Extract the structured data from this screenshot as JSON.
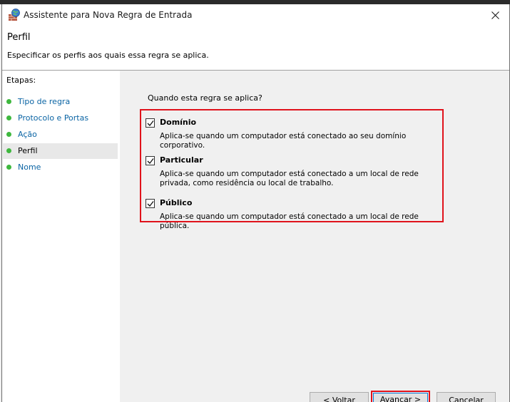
{
  "window": {
    "title": "Assistente para Nova Regra de Entrada"
  },
  "header": {
    "title": "Perfil",
    "subtitle": "Especificar os perfis aos quais essa regra se aplica."
  },
  "steps": {
    "heading": "Etapas:",
    "items": [
      {
        "label": "Tipo de regra"
      },
      {
        "label": "Protocolo e Portas"
      },
      {
        "label": "Ação"
      },
      {
        "label": "Perfil"
      },
      {
        "label": "Nome"
      }
    ]
  },
  "content": {
    "question": "Quando esta regra se aplica?",
    "options": [
      {
        "label": "Domínio",
        "checked": true,
        "description": "Aplica-se quando um computador está conectado ao seu domínio corporativo."
      },
      {
        "label": "Particular",
        "checked": true,
        "description": "Aplica-se quando um computador está conectado a um local de rede privada, como residência ou local de trabalho."
      },
      {
        "label": "Público",
        "checked": true,
        "description": "Aplica-se quando um computador está conectado a um local de rede pública."
      }
    ]
  },
  "buttons": {
    "back": "< Voltar",
    "next": "Avançar >",
    "cancel": "Cancelar"
  },
  "colors": {
    "highlight": "#e0121b",
    "step_link": "#0a64a4",
    "step_dot": "#3fb83f"
  }
}
